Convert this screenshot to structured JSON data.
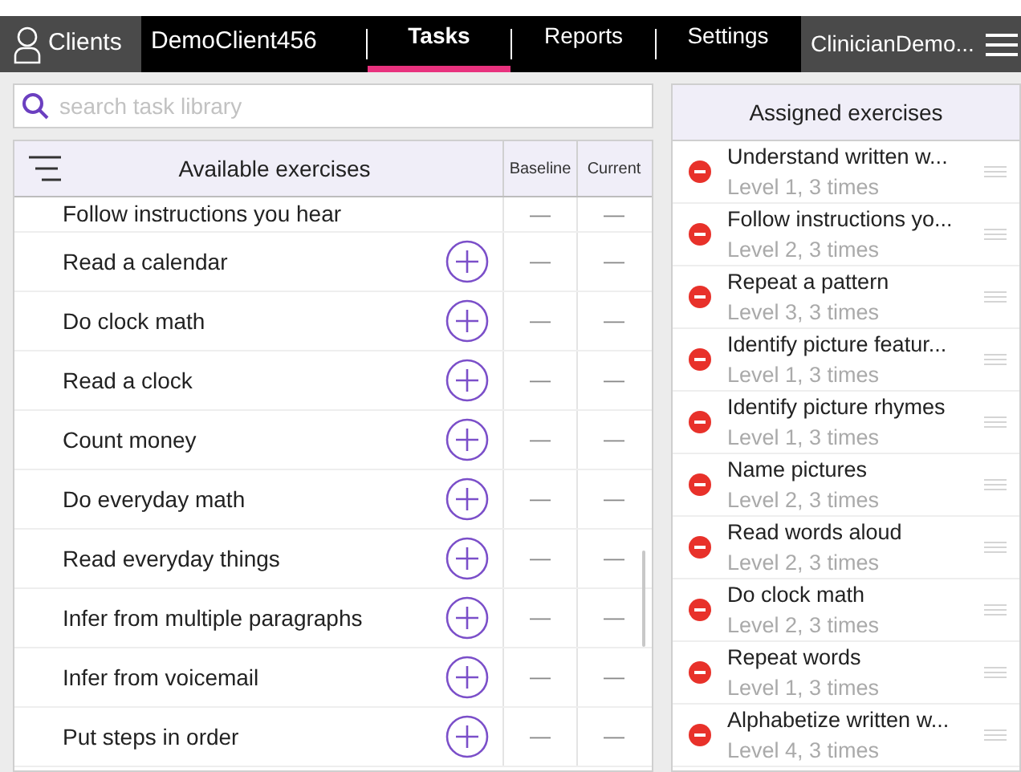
{
  "nav": {
    "clients": "Clients",
    "client_name": "DemoClient456",
    "tabs": [
      {
        "label": "Tasks",
        "selected": true
      },
      {
        "label": "Reports",
        "selected": false
      },
      {
        "label": "Settings",
        "selected": false
      }
    ],
    "user": "ClinicianDemo..."
  },
  "search": {
    "placeholder": "search task library"
  },
  "available": {
    "title": "Available exercises",
    "columns": [
      "Baseline",
      "Current"
    ],
    "rows": [
      {
        "name": "Follow instructions you hear",
        "baseline": "—",
        "current": "—"
      },
      {
        "name": "Read a calendar",
        "baseline": "—",
        "current": "—"
      },
      {
        "name": "Do clock math",
        "baseline": "—",
        "current": "—"
      },
      {
        "name": "Read a clock",
        "baseline": "—",
        "current": "—"
      },
      {
        "name": "Count money",
        "baseline": "—",
        "current": "—"
      },
      {
        "name": "Do everyday math",
        "baseline": "—",
        "current": "—"
      },
      {
        "name": "Read everyday things",
        "baseline": "—",
        "current": "—"
      },
      {
        "name": "Infer from multiple paragraphs",
        "baseline": "—",
        "current": "—"
      },
      {
        "name": "Infer from voicemail",
        "baseline": "—",
        "current": "—"
      },
      {
        "name": "Put steps in order",
        "baseline": "—",
        "current": "—"
      }
    ]
  },
  "assigned": {
    "title": "Assigned exercises",
    "items": [
      {
        "name": "Understand written w...",
        "detail": "Level 1, 3 times"
      },
      {
        "name": "Follow instructions yo...",
        "detail": "Level 2, 3 times"
      },
      {
        "name": "Repeat a pattern",
        "detail": "Level 3, 3 times"
      },
      {
        "name": "Identify picture featur...",
        "detail": "Level 1, 3 times"
      },
      {
        "name": "Identify picture rhymes",
        "detail": "Level 1, 3 times"
      },
      {
        "name": "Name pictures",
        "detail": "Level 2, 3 times"
      },
      {
        "name": "Read words aloud",
        "detail": "Level 2, 3 times"
      },
      {
        "name": "Do clock math",
        "detail": "Level 2, 3 times"
      },
      {
        "name": "Repeat words",
        "detail": "Level 1, 3 times"
      },
      {
        "name": "Alphabetize written w...",
        "detail": "Level 4, 3 times"
      }
    ]
  }
}
